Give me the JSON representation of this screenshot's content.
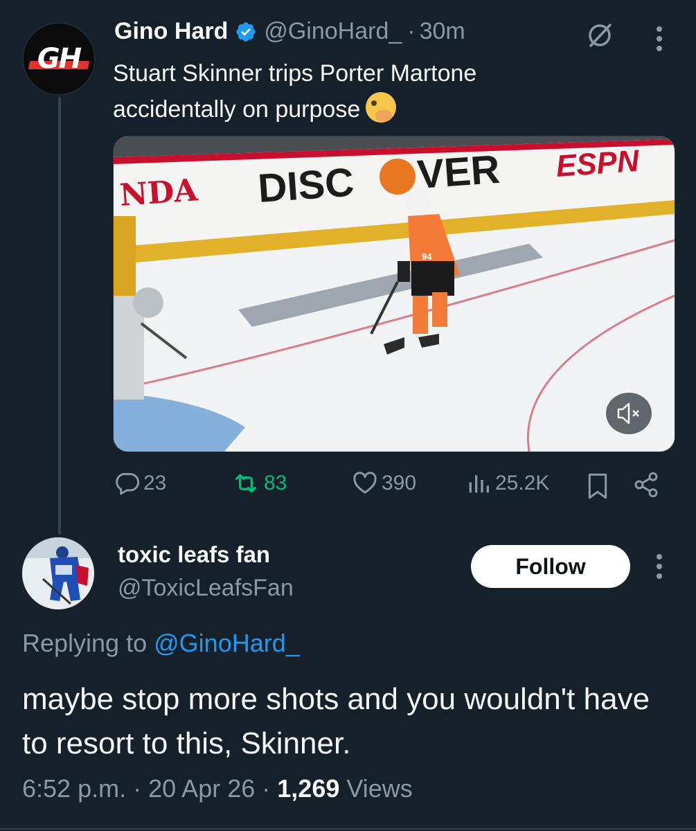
{
  "original_tweet": {
    "avatar_text": "GH",
    "display_name": "Gino Hard",
    "handle": "@GinoHard_",
    "separator": "·",
    "time_ago": "30m",
    "text": "Stuart Skinner trips Porter Martone accidentally on purpose",
    "emoji": "face-with-open-eyes-and-hand-over-mouth",
    "media": {
      "board_text_left": "NDA",
      "board_text_main_1": "DISC",
      "board_text_main_2": "VER",
      "board_text_right": "ESPN",
      "jersey_number": "94",
      "mute_icon": "volume-mute-icon"
    },
    "actions": {
      "replies": "23",
      "reposts": "83",
      "likes": "390",
      "views": "25.2K"
    },
    "colors": {
      "repost": "#00ba7c",
      "verified": "#1d9bf0",
      "link": "#1d9bf0"
    }
  },
  "reply": {
    "display_name": "toxic leafs fan",
    "handle": "@ToxicLeafsFan",
    "follow_label": "Follow",
    "replying_to_label": "Replying to",
    "replying_to_handle": "@GinoHard_",
    "text": "maybe stop more shots and you wouldn't have to resort to this, Skinner.",
    "time": "6:52 p.m.",
    "date": "20 Apr 26",
    "views_count": "1,269",
    "views_label": "Views",
    "dot": "·"
  }
}
